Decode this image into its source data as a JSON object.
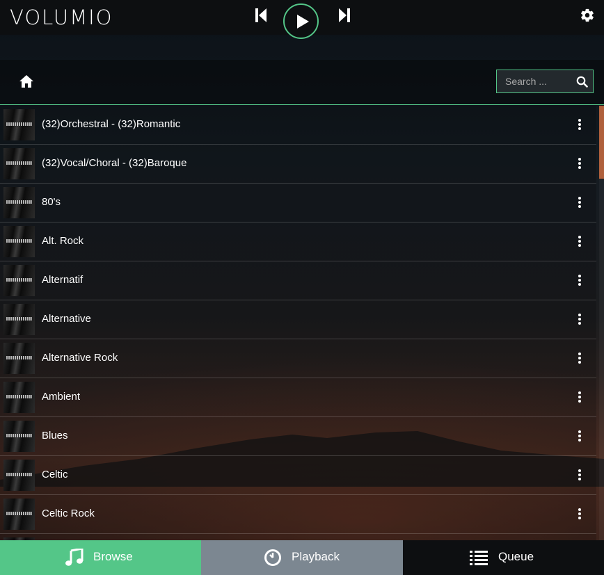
{
  "app": {
    "logo_text": "VOLUMIO",
    "accent_color": "#54c688"
  },
  "transport": {
    "prev_icon": "skip-back-icon",
    "play_icon": "play-icon",
    "next_icon": "skip-forward-icon",
    "settings_icon": "gear-icon"
  },
  "header": {
    "home_icon": "home-icon",
    "search_placeholder": "Search ...",
    "search_icon": "search-icon"
  },
  "list": {
    "items": [
      {
        "label": "(32)Orchestral - (32)Romantic"
      },
      {
        "label": "(32)Vocal/Choral - (32)Baroque"
      },
      {
        "label": "80's"
      },
      {
        "label": "Alt. Rock"
      },
      {
        "label": "Alternatif"
      },
      {
        "label": "Alternative"
      },
      {
        "label": "Alternative Rock"
      },
      {
        "label": "Ambient"
      },
      {
        "label": "Blues"
      },
      {
        "label": "Celtic"
      },
      {
        "label": "Celtic Rock"
      },
      {
        "label": ""
      }
    ]
  },
  "tabs": {
    "browse": "Browse",
    "playback": "Playback",
    "queue": "Queue"
  }
}
